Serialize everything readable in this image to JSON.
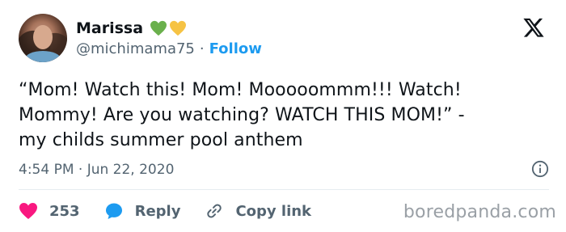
{
  "user": {
    "display_name": "Marissa",
    "handle": "@michimama75",
    "separator": "·",
    "follow_label": "Follow",
    "emoji_hearts": [
      "green-heart",
      "yellow-heart"
    ]
  },
  "tweet": {
    "text": "“Mom! Watch this! Mom! Mooooommm!!! Watch!\nMommy! Are you watching? WATCH THIS MOM!” -\nmy childs summer pool anthem",
    "timestamp": "4:54 PM · Jun 22, 2020"
  },
  "actions": {
    "like_count": "253",
    "reply_label": "Reply",
    "copy_link_label": "Copy link"
  },
  "watermark": "boredpanda.com",
  "colors": {
    "like": "#f91880",
    "reply": "#1d9bf0",
    "follow": "#1d9bf0",
    "heart_green": "#6ab04c",
    "heart_yellow": "#f6c344"
  }
}
